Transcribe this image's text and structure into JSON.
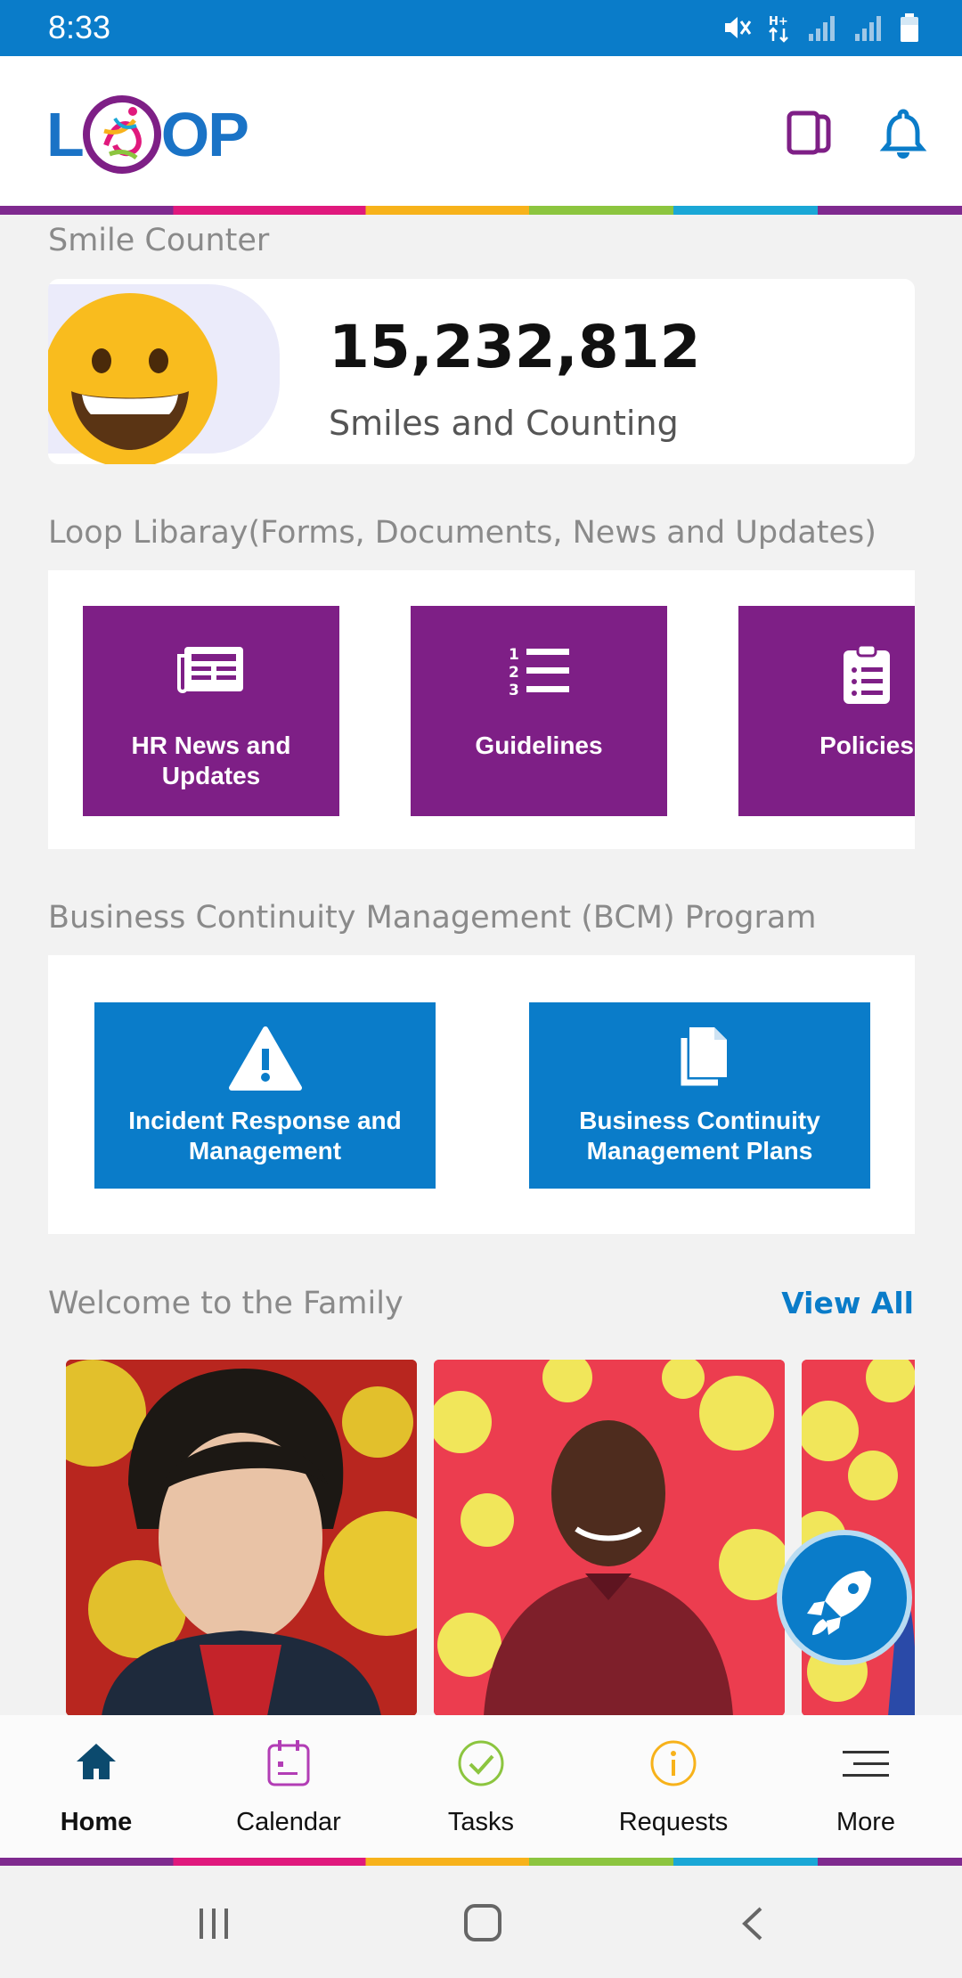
{
  "status_bar": {
    "time": "8:33",
    "icons": [
      "mute-icon",
      "data-icon",
      "signal-icon",
      "signal-icon",
      "battery-icon"
    ]
  },
  "header": {
    "logo_letters": [
      "L",
      "OP"
    ],
    "icons": [
      "cards-icon",
      "bell-icon"
    ]
  },
  "smile_counter": {
    "section_title": "Smile Counter",
    "count": "15,232,812",
    "caption": "Smiles and Counting"
  },
  "library": {
    "section_title": "Loop Libaray(Forms, Documents, News and Updates)",
    "tiles": [
      {
        "label": "HR News and Updates",
        "icon": "newspaper-icon"
      },
      {
        "label": "Guidelines",
        "icon": "numbered-list-icon"
      },
      {
        "label": "Policies",
        "icon": "clipboard-list-icon"
      }
    ]
  },
  "bcm": {
    "section_title": "Business Continuity Management (BCM) Program",
    "tiles": [
      {
        "label": "Incident Response and Management",
        "icon": "warning-icon"
      },
      {
        "label": "Business Continuity Management Plans",
        "icon": "documents-icon"
      }
    ]
  },
  "welcome": {
    "section_title": "Welcome to the Family",
    "view_all": "View All"
  },
  "bottom_nav": [
    {
      "label": "Home",
      "icon": "home-icon",
      "active": true
    },
    {
      "label": "Calendar",
      "icon": "calendar-icon"
    },
    {
      "label": "Tasks",
      "icon": "check-circle-icon"
    },
    {
      "label": "Requests",
      "icon": "info-circle-icon"
    },
    {
      "label": "More",
      "icon": "menu-icon"
    }
  ],
  "colors": {
    "primary_blue": "#0a7cc9",
    "purple": "#7e1f86",
    "calendar_purple": "#b23db5",
    "tasks_green": "#8cc53f",
    "requests_yellow": "#f7b21b"
  }
}
